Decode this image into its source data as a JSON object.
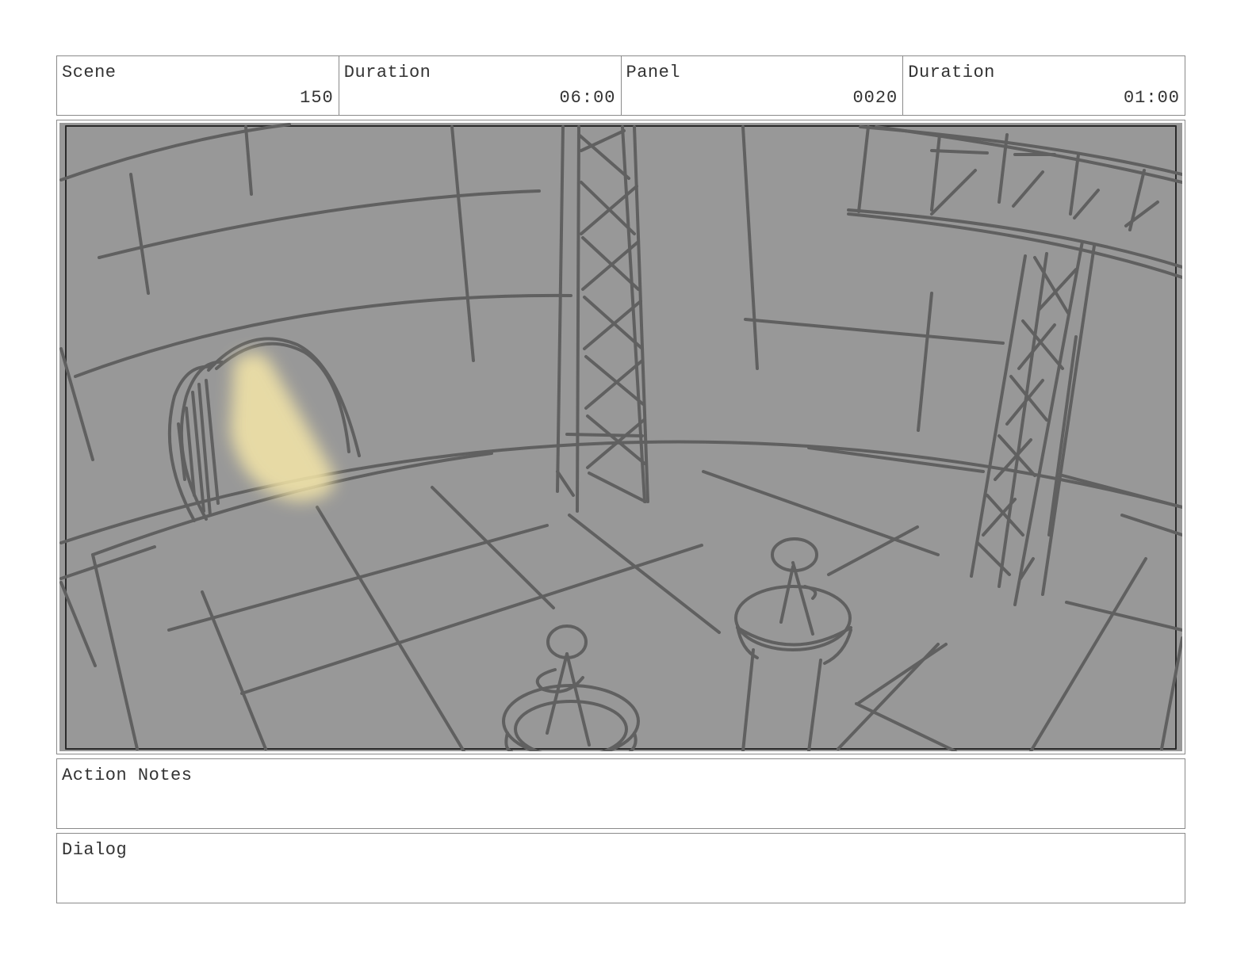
{
  "header": {
    "scene_label": "Scene",
    "scene_value": "150",
    "scene_duration_label": "Duration",
    "scene_duration_value": "06:00",
    "panel_label": "Panel",
    "panel_value": "0020",
    "panel_duration_label": "Duration",
    "panel_duration_value": "01:00"
  },
  "notes": {
    "action_label": "Action Notes",
    "dialog_label": "Dialog"
  },
  "colors": {
    "panel_background": "#989898",
    "sketch_stroke": "#606060",
    "light_beam": "#f5e6a8"
  }
}
